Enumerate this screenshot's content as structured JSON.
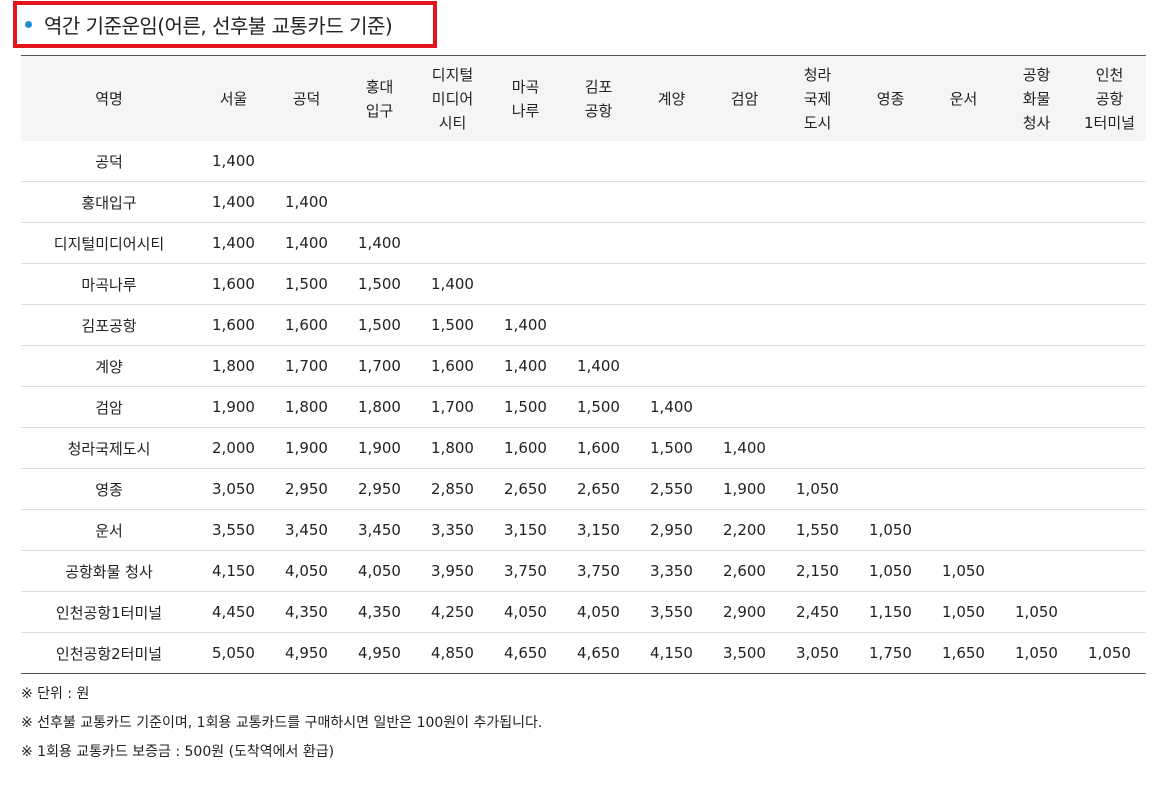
{
  "title": "역간 기준운임(어른, 선후불 교통카드 기준)",
  "table": {
    "headers": [
      [
        "역명"
      ],
      [
        "서울"
      ],
      [
        "공덕"
      ],
      [
        "홍대",
        "입구"
      ],
      [
        "디지털",
        "미디어",
        "시티"
      ],
      [
        "마곡",
        "나루"
      ],
      [
        "김포",
        "공항"
      ],
      [
        "계양"
      ],
      [
        "검암"
      ],
      [
        "청라",
        "국제",
        "도시"
      ],
      [
        "영종"
      ],
      [
        "운서"
      ],
      [
        "공항",
        "화물",
        "청사"
      ],
      [
        "인천",
        "공항",
        "1터미널"
      ]
    ],
    "rows": [
      {
        "station": "공덕",
        "fares": [
          "1,400"
        ]
      },
      {
        "station": "홍대입구",
        "fares": [
          "1,400",
          "1,400"
        ]
      },
      {
        "station": "디지털미디어시티",
        "fares": [
          "1,400",
          "1,400",
          "1,400"
        ]
      },
      {
        "station": "마곡나루",
        "fares": [
          "1,600",
          "1,500",
          "1,500",
          "1,400"
        ]
      },
      {
        "station": "김포공항",
        "fares": [
          "1,600",
          "1,600",
          "1,500",
          "1,500",
          "1,400"
        ]
      },
      {
        "station": "계양",
        "fares": [
          "1,800",
          "1,700",
          "1,700",
          "1,600",
          "1,400",
          "1,400"
        ]
      },
      {
        "station": "검암",
        "fares": [
          "1,900",
          "1,800",
          "1,800",
          "1,700",
          "1,500",
          "1,500",
          "1,400"
        ]
      },
      {
        "station": "청라국제도시",
        "fares": [
          "2,000",
          "1,900",
          "1,900",
          "1,800",
          "1,600",
          "1,600",
          "1,500",
          "1,400"
        ]
      },
      {
        "station": "영종",
        "fares": [
          "3,050",
          "2,950",
          "2,950",
          "2,850",
          "2,650",
          "2,650",
          "2,550",
          "1,900",
          "1,050"
        ]
      },
      {
        "station": "운서",
        "fares": [
          "3,550",
          "3,450",
          "3,450",
          "3,350",
          "3,150",
          "3,150",
          "2,950",
          "2,200",
          "1,550",
          "1,050"
        ]
      },
      {
        "station": "공항화물 청사",
        "fares": [
          "4,150",
          "4,050",
          "4,050",
          "3,950",
          "3,750",
          "3,750",
          "3,350",
          "2,600",
          "2,150",
          "1,050",
          "1,050"
        ]
      },
      {
        "station": "인천공항1터미널",
        "fares": [
          "4,450",
          "4,350",
          "4,350",
          "4,250",
          "4,050",
          "4,050",
          "3,550",
          "2,900",
          "2,450",
          "1,150",
          "1,050",
          "1,050"
        ]
      },
      {
        "station": "인천공항2터미널",
        "fares": [
          "5,050",
          "4,950",
          "4,950",
          "4,850",
          "4,650",
          "4,650",
          "4,150",
          "3,500",
          "3,050",
          "1,750",
          "1,650",
          "1,050",
          "1,050"
        ]
      }
    ]
  },
  "notes": [
    "※ 단위 : 원",
    "※ 선후불 교통카드 기준이며, 1회용 교통카드를 구매하시면 일반은 100원이 추가됩니다.",
    "※ 1회용 교통카드 보증금 : 500원 (도착역에서 환급)"
  ]
}
